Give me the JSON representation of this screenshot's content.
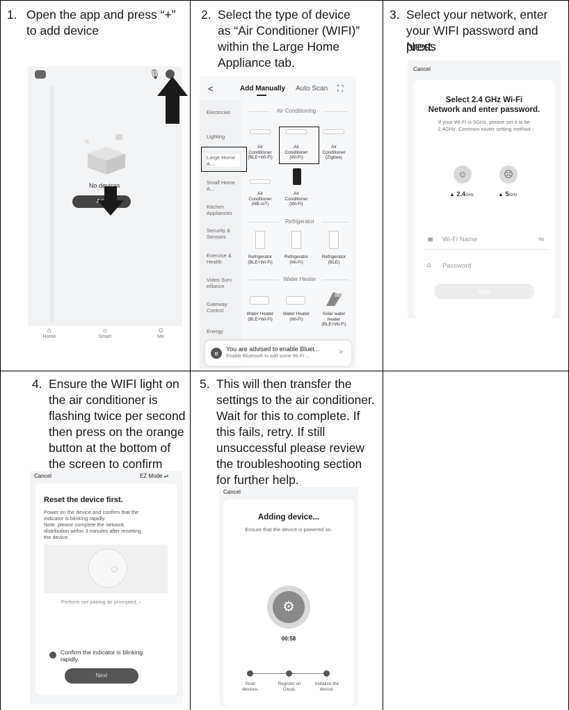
{
  "steps": [
    {
      "number": "1.",
      "lines": [
        "Open the app and press “+”",
        "to add device"
      ]
    },
    {
      "number": "2.",
      "lines": [
        "Select the type of device",
        "as “Air Conditioner (WIFI)”",
        "within the Large Home",
        "Appliance tab."
      ]
    },
    {
      "number": "3.",
      "lines": [
        "Select your network, enter",
        "your WIFI password and press",
        "Next."
      ]
    },
    {
      "number": "4.",
      "lines": [
        "Ensure the WIFI light on",
        "the air conditioner is",
        "flashing twice per second",
        "then press on the orange",
        "button at the bottom of",
        "the screen to confirm"
      ]
    },
    {
      "number": "5.",
      "lines": [
        "This will then transfer the",
        "settings to the air conditioner.",
        "Wait for this to complete. If",
        "this fails, retry. If still",
        "unsuccessful please review",
        "the troubleshooting section",
        "for further help."
      ]
    }
  ],
  "screen1": {
    "no_devices": "No devices",
    "add_button": "Add",
    "nav": [
      "Home",
      "Smart",
      "Me"
    ]
  },
  "screen2": {
    "back": "<",
    "tab_manual": "Add Manually",
    "tab_scan": "Auto Scan",
    "sidebar": [
      "Electrician",
      "Lighting",
      "Large Home A...",
      "Small Home A...",
      "Kitchen Appliances",
      "Security & Sensors",
      "Exercise & Health",
      "Video Surv eillance",
      "Gateway Control",
      "Energy"
    ],
    "sections": {
      "ac": "Air Conditioning",
      "fridge": "Refrigerator",
      "heater": "Water Heater"
    },
    "ac_devices": [
      [
        "Air",
        "Conditioner",
        "(BLE+Wi-Fi)"
      ],
      [
        "Air",
        "Conditioner",
        "(Wi-Fi)"
      ],
      [
        "Air",
        "Conditioner",
        "(Zigbee)"
      ],
      [
        "Air",
        "Conditioner",
        "(NB-IoT)"
      ],
      [
        "Air",
        "Conditioner",
        "(Wi-Fi)"
      ]
    ],
    "fridge_devices": [
      [
        "Refrigerator",
        "(BLE+Wi-Fi)"
      ],
      [
        "Refrigerator",
        "(Wi-Fi)"
      ],
      [
        "Refrigerator",
        "(BLE)"
      ]
    ],
    "heater_devices": [
      [
        "Water Heater",
        "(BLE+Wi-Fi)"
      ],
      [
        "Water Heater",
        "(Wi-Fi)"
      ],
      [
        "Solar water",
        "heater",
        "(BLE+Wi-Fi)"
      ]
    ],
    "banner_title": "You are advised to enable Bluet...",
    "banner_sub": "Enable Bluetooth to add some Wi-Fi ...",
    "banner_chevron": ">"
  },
  "screen3": {
    "cancel": "Cancel",
    "title_lines": [
      "Select 2.4 GHz Wi-Fi",
      "Network and enter password."
    ],
    "sub_lines": [
      "If your Wi-Fi is 5GHz, please set it to be",
      "2.4GHz. Common router setting method"
    ],
    "band_good": "2.4",
    "band_good_unit": "GHz",
    "band_bad": "5",
    "band_bad_unit": "GHz",
    "wifi_placeholder": "Wi-Fi Name",
    "password_placeholder": "Password",
    "next": "Next"
  },
  "screen4": {
    "cancel": "Cancel",
    "mode": "EZ Mode ⇌",
    "title": "Reset the device first.",
    "desc_lines": [
      "Power on the device and confirm that the",
      "indicator is blinking rapidly.",
      "Note: please complete the network",
      "distribution within 3 minutes after resetting",
      "the device."
    ],
    "prompt": "Perform net pairing as prompted. ›",
    "confirm_lines": [
      "Confirm the indicator is blinking",
      "rapidly."
    ],
    "next": "Next"
  },
  "screen5": {
    "cancel": "Cancel",
    "title": "Adding device...",
    "sub": "Ensure that the device is powered on.",
    "timer": "00:58",
    "steps": [
      [
        "Scan",
        "devices."
      ],
      [
        "Register on",
        "Cloud."
      ],
      [
        "Initialize the",
        "device."
      ]
    ]
  },
  "colors": {
    "border": "#000000",
    "screen_bg": "#f4f5f7",
    "dark_button": "#555555"
  }
}
